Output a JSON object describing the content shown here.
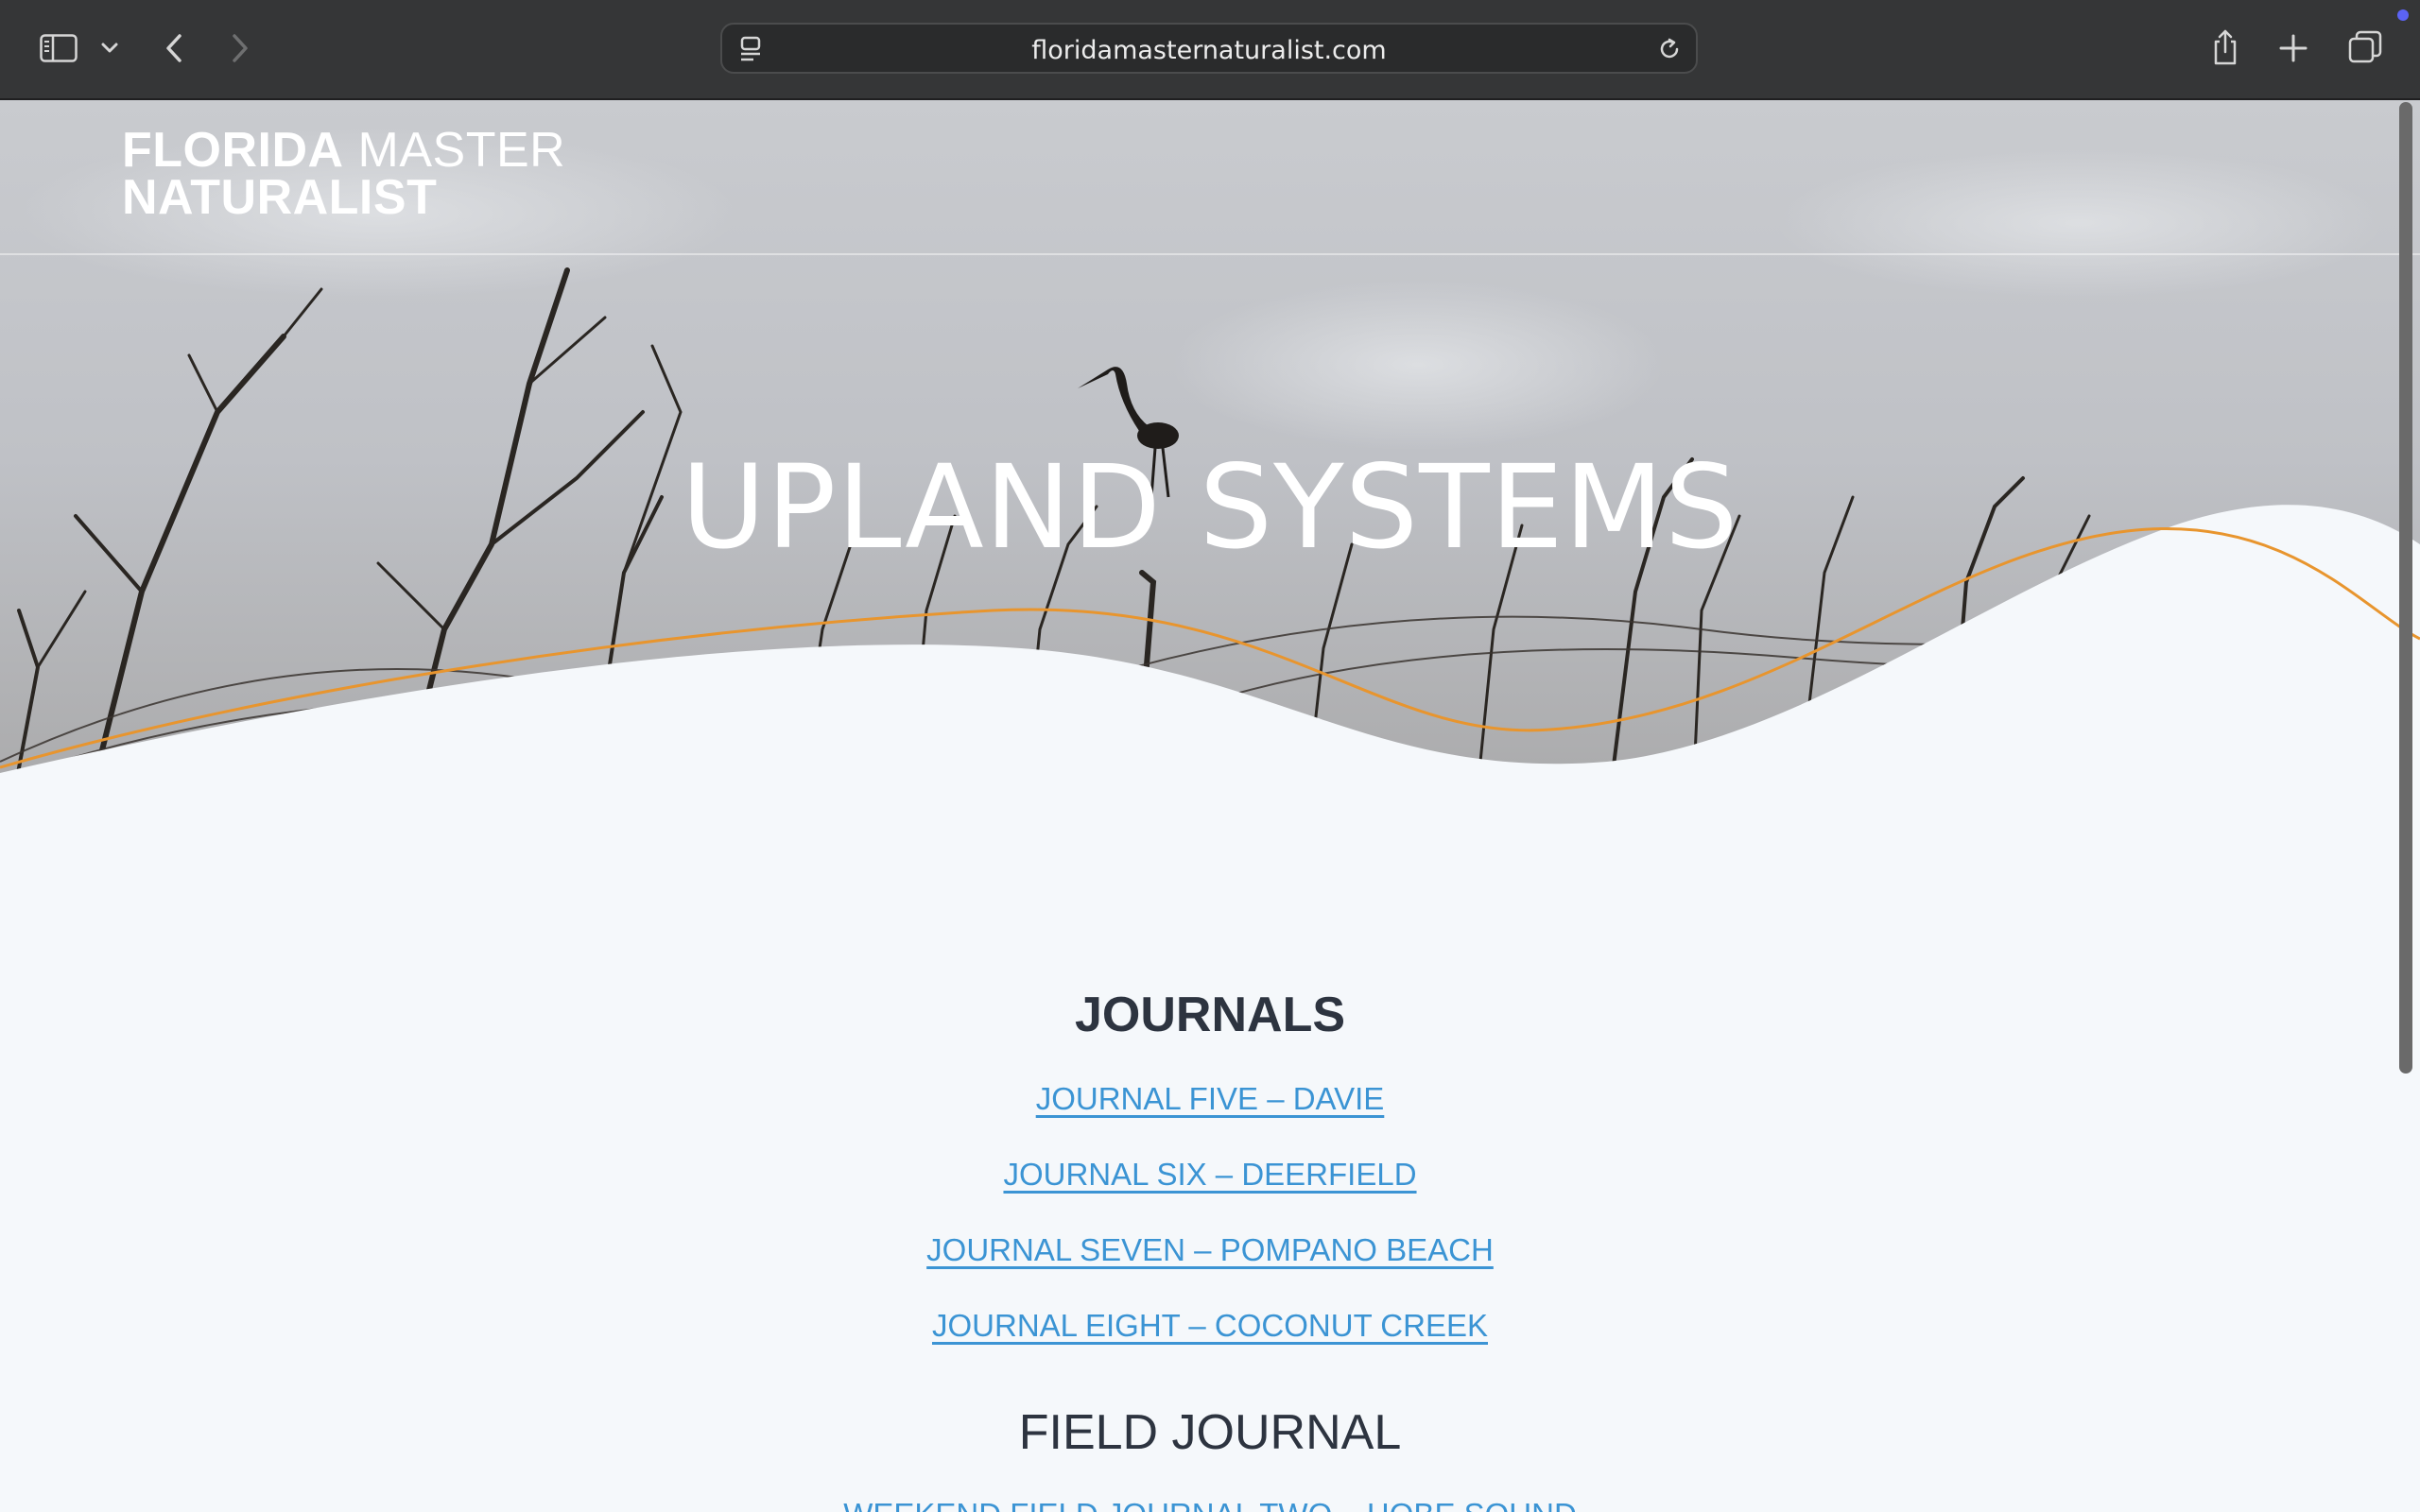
{
  "browser": {
    "url": "floridamasternaturalist.com",
    "icons": [
      "sidebar-icon",
      "chevron-down-icon",
      "back-icon",
      "forward-icon",
      "page-settings-icon",
      "reload-icon",
      "share-icon",
      "new-tab-icon",
      "tabs-overview-icon"
    ]
  },
  "site": {
    "logo_line1_bold": "FLORIDA",
    "logo_line1_light": "MASTER",
    "logo_line2": "NATURALIST"
  },
  "hero": {
    "title": "UPLAND SYSTEMS",
    "accent_color": "#e8952e"
  },
  "journals": {
    "heading": "JOURNALS",
    "links": [
      "JOURNAL FIVE – DAVIE",
      "JOURNAL SIX – DEERFIELD",
      "JOURNAL SEVEN – POMPANO BEACH",
      "JOURNAL EIGHT – COCONUT CREEK"
    ]
  },
  "field_journal": {
    "heading": "FIELD JOURNAL",
    "links": [
      "WEEKEND FIELD JOURNAL TWO – HOBE SOUND"
    ]
  },
  "colors": {
    "link": "#3b94d4",
    "heading": "#2d3440",
    "page_bg": "#f5f8fb"
  }
}
